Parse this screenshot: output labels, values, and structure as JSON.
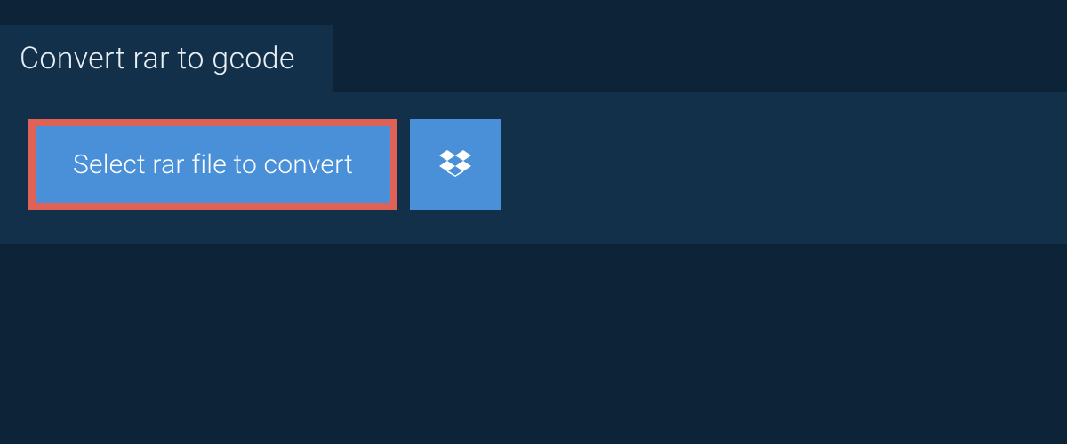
{
  "tab": {
    "title": "Convert rar to gcode"
  },
  "buttons": {
    "select_file_label": "Select rar file to convert"
  },
  "colors": {
    "page_bg": "#0d2438",
    "panel_bg": "#12304a",
    "button_bg": "#4a90d9",
    "highlight_border": "#e06256",
    "text_light": "#e8eef4",
    "text_white": "#ffffff"
  }
}
